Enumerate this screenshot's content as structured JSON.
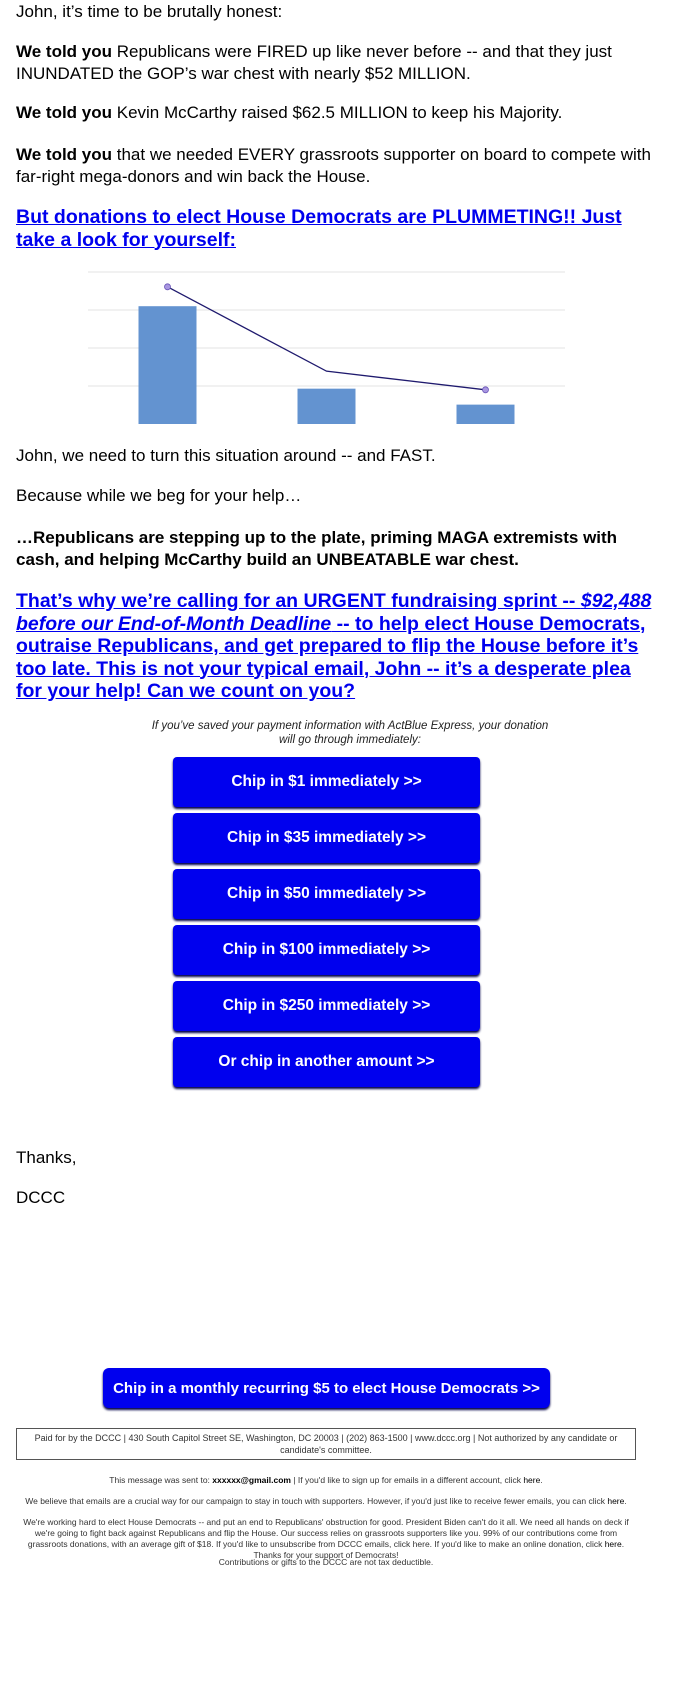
{
  "body": {
    "greeting": "John, it’s time to be brutally honest:",
    "told1_bold": "We told you",
    "told1": " Republicans were FIRED up like never before -- and that they just INUNDATED the GOP’s war chest with nearly $52 MILLION.",
    "told2_bold": "We told you",
    "told2": " Kevin McCarthy raised $62.5 MILLION to keep his Majority.",
    "told3_bold": "We told you",
    "told3": " that we needed EVERY grassroots supporter on board to compete with far-right mega-donors and win back the House.",
    "headline1": "But donations to elect House Democrats are PLUMMETING!! Just take a look for yourself:",
    "turn_around": "John, we need to turn this situation around -- and FAST.",
    "beg": "Because while we beg for your help…",
    "republicans": "…Republicans are stepping up to the plate, priming MAGA extremists with cash, and helping McCarthy build an UNBEATABLE war chest.",
    "headline2_a": "That’s why we’re calling for an URGENT fundraising sprint -- ",
    "headline2_italic": "$92,488 before our End-of-Month Deadline",
    "headline2_b": " -- to help elect House Democrats, outraise Republicans, and get prepared to flip the House before it’s too late. This is not your typical email, John -- it’s a desperate plea for your help! Can we count on you?",
    "actblue_caption": "If you’ve saved your payment information with ActBlue Express, your donation will go through immediately:",
    "thanks": "Thanks,",
    "signature": "DCCC"
  },
  "buttons": [
    {
      "label": "Chip in $1 immediately >>"
    },
    {
      "label": "Chip in $35 immediately >>"
    },
    {
      "label": "Chip in $50 immediately >>"
    },
    {
      "label": "Chip in $100 immediately >>"
    },
    {
      "label": "Chip in $250 immediately >>"
    },
    {
      "label": "Or chip in another amount >>"
    }
  ],
  "monthly_button": "Chip in a monthly recurring $5 to elect House Democrats >>",
  "footer": {
    "paid_for": "Paid for by the DCCC | 430 South Capitol Street SE, Washington, DC 20003 | (202) 863-1500 | www.dccc.org | Not authorized by any candidate or candidate's committee.",
    "sent_to_prefix": "This message was sent to: ",
    "sent_to_email": "xxxxxx@gmail.com",
    "sent_to_suffix": " | If you'd like to sign up for emails in a different account, click ",
    "here": "here",
    "period": ".",
    "fewer_emails": "We believe that emails are a crucial way for our campaign to stay in touch with supporters. However, if you'd just like to receive fewer emails, you can click ",
    "working_hard": "We're working hard to elect House Democrats -- and put an end to Republicans' obstruction for good. President Biden can't do it all. We need all hands on deck if we're going to fight back against Republicans and flip the House. Our success relies on grassroots supporters like you. 99% of our contributions come from grassroots donations, with an average gift of $18. If you'd like to unsubscribe from DCCC emails, click here. If you'd like to make an online donation, click ",
    "thanks_support": ". Thanks for your support of Democrats!",
    "tax": "Contributions or gifts to the DCCC are not tax deductible."
  },
  "colors": {
    "link": "#0000ee",
    "button": "#0000ee",
    "bar": "#6393d0",
    "line": "#1f1a6e",
    "marker": "#a896e0"
  },
  "chart_data": {
    "type": "bar",
    "categories": [
      "",
      "",
      ""
    ],
    "series": [
      {
        "type": "bar",
        "values": [
          3.1,
          0.93,
          0.51
        ]
      },
      {
        "type": "line",
        "values": [
          3.61,
          1.39,
          0.9
        ]
      }
    ],
    "ylim": [
      0,
      4
    ],
    "grid": true,
    "title": "",
    "xlabel": "",
    "ylabel": ""
  }
}
